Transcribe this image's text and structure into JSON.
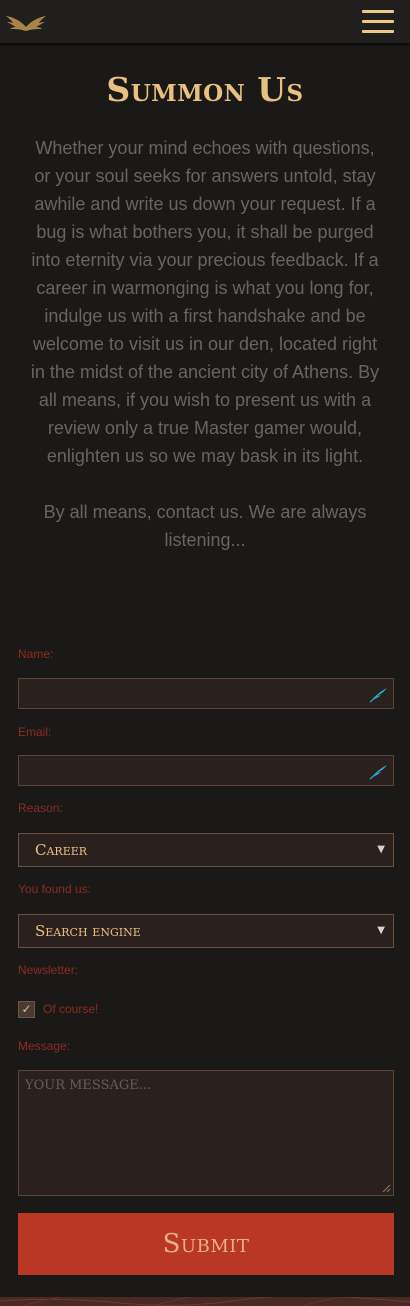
{
  "header": {
    "logo_icon": "wings-icon",
    "menu_icon": "hamburger-menu-icon"
  },
  "page_title": "Summon Us",
  "intro": {
    "paragraph1": "Whether your mind echoes with questions, or your soul seeks for answers untold, stay awhile and write us down your request. If a bug is what bothers you, it shall be purged into eternity via your precious feedback. If a career in warmonging is what you long for, indulge us with a first handshake and be welcome to visit us in our den, located right in the midst of the ancient city of Athens. By all means, if you wish to present us with a review only a true Master gamer would, enlighten us so we may bask in its light.",
    "paragraph2": "By all means, contact us. We are always listening..."
  },
  "form": {
    "name_label": "Name:",
    "name_value": "",
    "email_label": "Email:",
    "email_value": "",
    "reason_label": "Reason:",
    "reason_value": "Career",
    "found_label": "You found us:",
    "found_value": "Search engine",
    "newsletter_label": "Newsletter:",
    "newsletter_checked": true,
    "newsletter_option": "Of course!",
    "message_label": "Message:",
    "message_placeholder": "YOUR MESSAGE...",
    "submit_label": "Submit"
  },
  "colors": {
    "background": "#1a1918",
    "accent_gold": "#e8c080",
    "label_red": "#8e2a22",
    "submit_red": "#b83725",
    "icon_teal": "#2aa8c8"
  }
}
